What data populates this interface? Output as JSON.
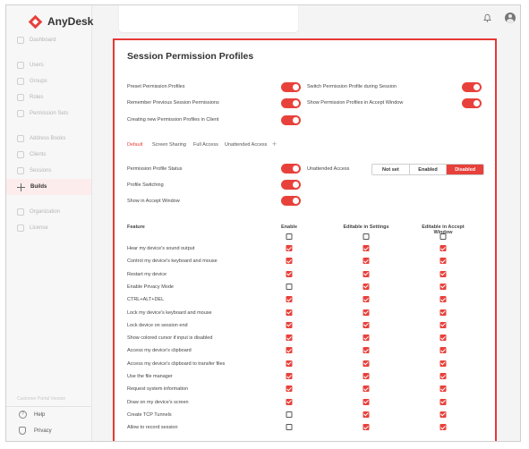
{
  "app": {
    "name": "AnyDesk"
  },
  "sidebar": {
    "items": [
      {
        "label": "Dashboard"
      },
      {
        "label": "Users"
      },
      {
        "label": "Groups"
      },
      {
        "label": "Roles"
      },
      {
        "label": "Permission Sets"
      },
      {
        "label": "Address Books"
      },
      {
        "label": "Clients"
      },
      {
        "label": "Sessions"
      },
      {
        "label": "Builds"
      },
      {
        "label": "Organization"
      },
      {
        "label": "License"
      }
    ],
    "active": "Builds",
    "footnote": "Customer Portal Version",
    "footer": [
      {
        "label": "Help"
      },
      {
        "label": "Privacy"
      }
    ]
  },
  "panel": {
    "title": "Session Permission Profiles",
    "settings_left": [
      {
        "label": "Preset Permission Profiles",
        "on": true
      },
      {
        "label": "Remember Previous Session Permissions",
        "on": true
      },
      {
        "label": "Creating new Permission Profiles in Client",
        "on": true
      }
    ],
    "settings_right": [
      {
        "label": "Switch Permission Profile during Session",
        "on": true
      },
      {
        "label": "Show Permission Profiles in Accept Window",
        "on": true
      }
    ],
    "tabs": [
      "Default",
      "Screen Sharing",
      "Full Access",
      "Unattended Access"
    ],
    "active_tab": "Default",
    "add_tab_glyph": "+",
    "profile_settings": [
      {
        "label": "Permission Profile Status",
        "on": true
      },
      {
        "label": "Profile Switching",
        "on": true
      },
      {
        "label": "Show in Accept Window",
        "on": true
      }
    ],
    "unattended": {
      "label": "Unattended Access",
      "options": [
        "Not set",
        "Enabled",
        "Disabled"
      ],
      "selected": "Disabled"
    },
    "table": {
      "headers": [
        "Feature",
        "Enable",
        "Editable in Settings",
        "Editable in Accept Window"
      ],
      "header_checks": [
        false,
        false,
        false
      ],
      "rows": [
        {
          "feature": "Hear my device's sound output",
          "checks": [
            true,
            true,
            true
          ]
        },
        {
          "feature": "Control my device's keyboard and mouse",
          "checks": [
            true,
            true,
            true
          ]
        },
        {
          "feature": "Restart my device",
          "checks": [
            true,
            true,
            true
          ]
        },
        {
          "feature": "Enable Privacy Mode",
          "checks": [
            false,
            true,
            true
          ]
        },
        {
          "feature": "CTRL+ALT+DEL",
          "checks": [
            true,
            true,
            true
          ]
        },
        {
          "feature": "Lock my device's keyboard and mouse",
          "checks": [
            true,
            true,
            true
          ]
        },
        {
          "feature": "Lock device on session end",
          "checks": [
            true,
            true,
            true
          ]
        },
        {
          "feature": "Show colored cursor if input is disabled",
          "checks": [
            true,
            true,
            true
          ]
        },
        {
          "feature": "Access my device's clipboard",
          "checks": [
            true,
            true,
            true
          ]
        },
        {
          "feature": "Access my device's clipboard to transfer files",
          "checks": [
            true,
            true,
            true
          ]
        },
        {
          "feature": "Use the file manager",
          "checks": [
            true,
            true,
            true
          ]
        },
        {
          "feature": "Request system information",
          "checks": [
            true,
            true,
            true
          ]
        },
        {
          "feature": "Draw on my device's screen",
          "checks": [
            true,
            true,
            true
          ]
        },
        {
          "feature": "Create TCP Tunnels",
          "checks": [
            false,
            true,
            true
          ]
        },
        {
          "feature": "Allow to record session",
          "checks": [
            false,
            true,
            true
          ]
        }
      ]
    }
  },
  "colors": {
    "accent": "#e8413b",
    "highlight": "#e53935"
  },
  "icons": [
    "anydesk-logo-icon",
    "bell-icon",
    "avatar-icon",
    "help-icon",
    "privacy-icon",
    "plus-icon",
    "check-icon"
  ]
}
